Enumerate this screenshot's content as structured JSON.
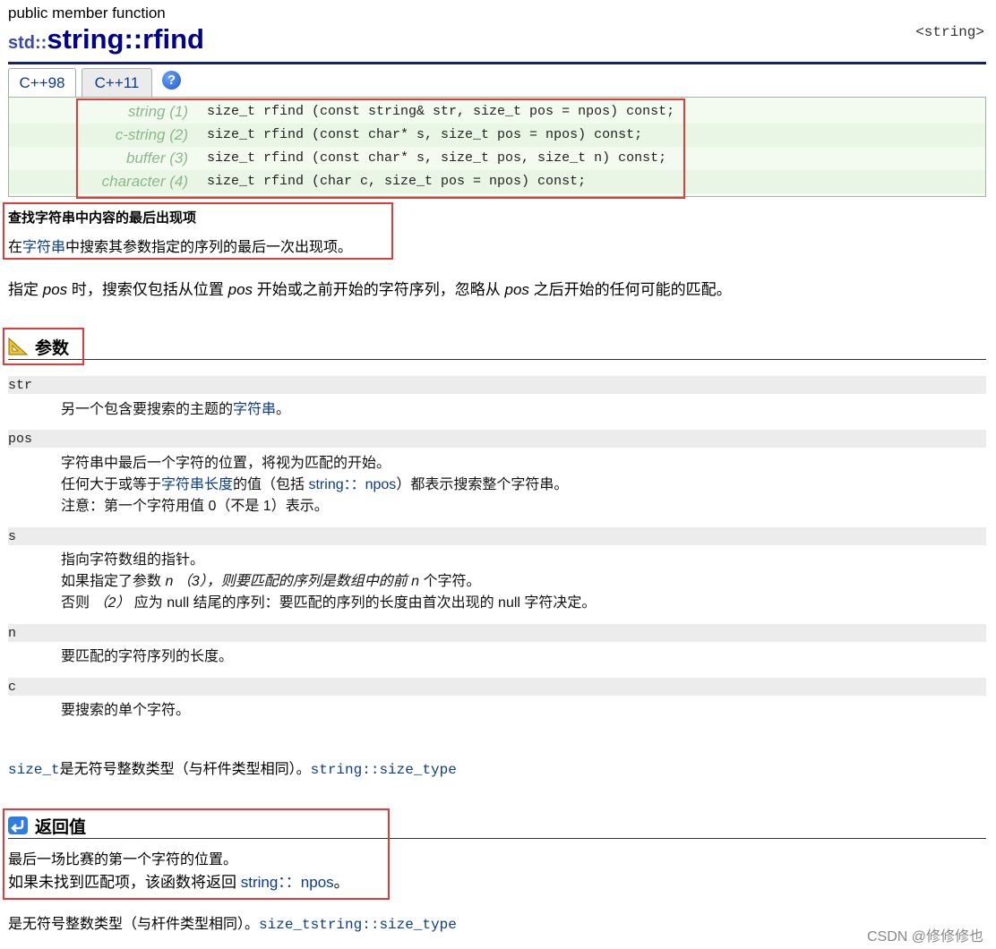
{
  "header": {
    "kind": "public member function",
    "namespace": "std::",
    "name": "string::rfind",
    "tag": "<string>"
  },
  "tabs": [
    {
      "label": "C++98"
    },
    {
      "label": "C++11"
    }
  ],
  "help_icon": "question-mark",
  "prototypes": [
    {
      "label": "string (1)",
      "code": "size_t rfind (const string& str, size_t pos = npos) const;"
    },
    {
      "label": "c-string (2)",
      "code": "size_t rfind (const char* s, size_t pos = npos) const;"
    },
    {
      "label": "buffer (3)",
      "code": "size_t rfind (const char* s, size_t pos, size_t n) const;"
    },
    {
      "label": "character (4)",
      "code": "size_t rfind (char c, size_t pos = npos) const;"
    }
  ],
  "summary": {
    "title": "查找字符串中内容的最后出现项",
    "desc_pre": "在",
    "desc_link": "字符串",
    "desc_post": "中搜索其参数指定的序列的最后一次出现项。",
    "note_a": "指定 ",
    "note_b": "pos",
    "note_c": " 时，搜索仅包括从位置 ",
    "note_d": "pos",
    "note_e": " 开始或之前开始的字符序列，忽略从 ",
    "note_f": "pos",
    "note_g": " 之后开始的任何可能的匹配。"
  },
  "params_section": {
    "title": "参数",
    "items": [
      {
        "name": "str",
        "l1_pre": "另一个包含要搜索的主题的",
        "l1_link": "字符串",
        "l1_post": "。"
      },
      {
        "name": "pos",
        "l1": "字符串中最后一个字符的位置，将视为匹配的开始。",
        "l2_a": "任何大于或等于",
        "l2_link": "字符串长度",
        "l2_b": "的值（包括 ",
        "l2_code": "string：：npos",
        "l2_c": "）都表示搜索整个字符串。",
        "l3": "注意：第一个字符用值 0（不是 1）表示。"
      },
      {
        "name": "s",
        "l1": "指向字符数组的指针。",
        "l2_a": "如果指定了参数 ",
        "l2_n": "n",
        "l2_b": " （3），则要匹配的序列是数组中的前 ",
        "l2_n2": "n",
        "l2_c": " 个字符。",
        "l3_a": "否则 ",
        "l3_b": "（2）",
        "l3_c": " 应为 null 结尾的序列：要匹配的序列的长度由首次出现的 null 字符决定。"
      },
      {
        "name": "n",
        "l1": "要匹配的字符序列的长度。"
      },
      {
        "name": "c",
        "l1": "要搜索的单个字符。"
      }
    ],
    "size_t_code": "size_t",
    "size_t_text": "是无符号整数类型（与杆件类型相同）。",
    "size_t_link": "string::size_type"
  },
  "return_section": {
    "title": "返回值",
    "line1": "最后一场比赛的第一个字符的位置。",
    "line2_a": "如果未找到匹配项，该函数将返回 ",
    "line2_code": "string：：npos",
    "line2_b": "。",
    "type_text": "是无符号整数类型（与杆件类型相同）。",
    "type_link": "size_tstring::size_type"
  },
  "watermark": "CSDN @修修修也",
  "colors": {
    "highlight_box": "#e23b3b",
    "link": "#0a3c8a",
    "title": "#00008b",
    "rule": "#18206a"
  }
}
